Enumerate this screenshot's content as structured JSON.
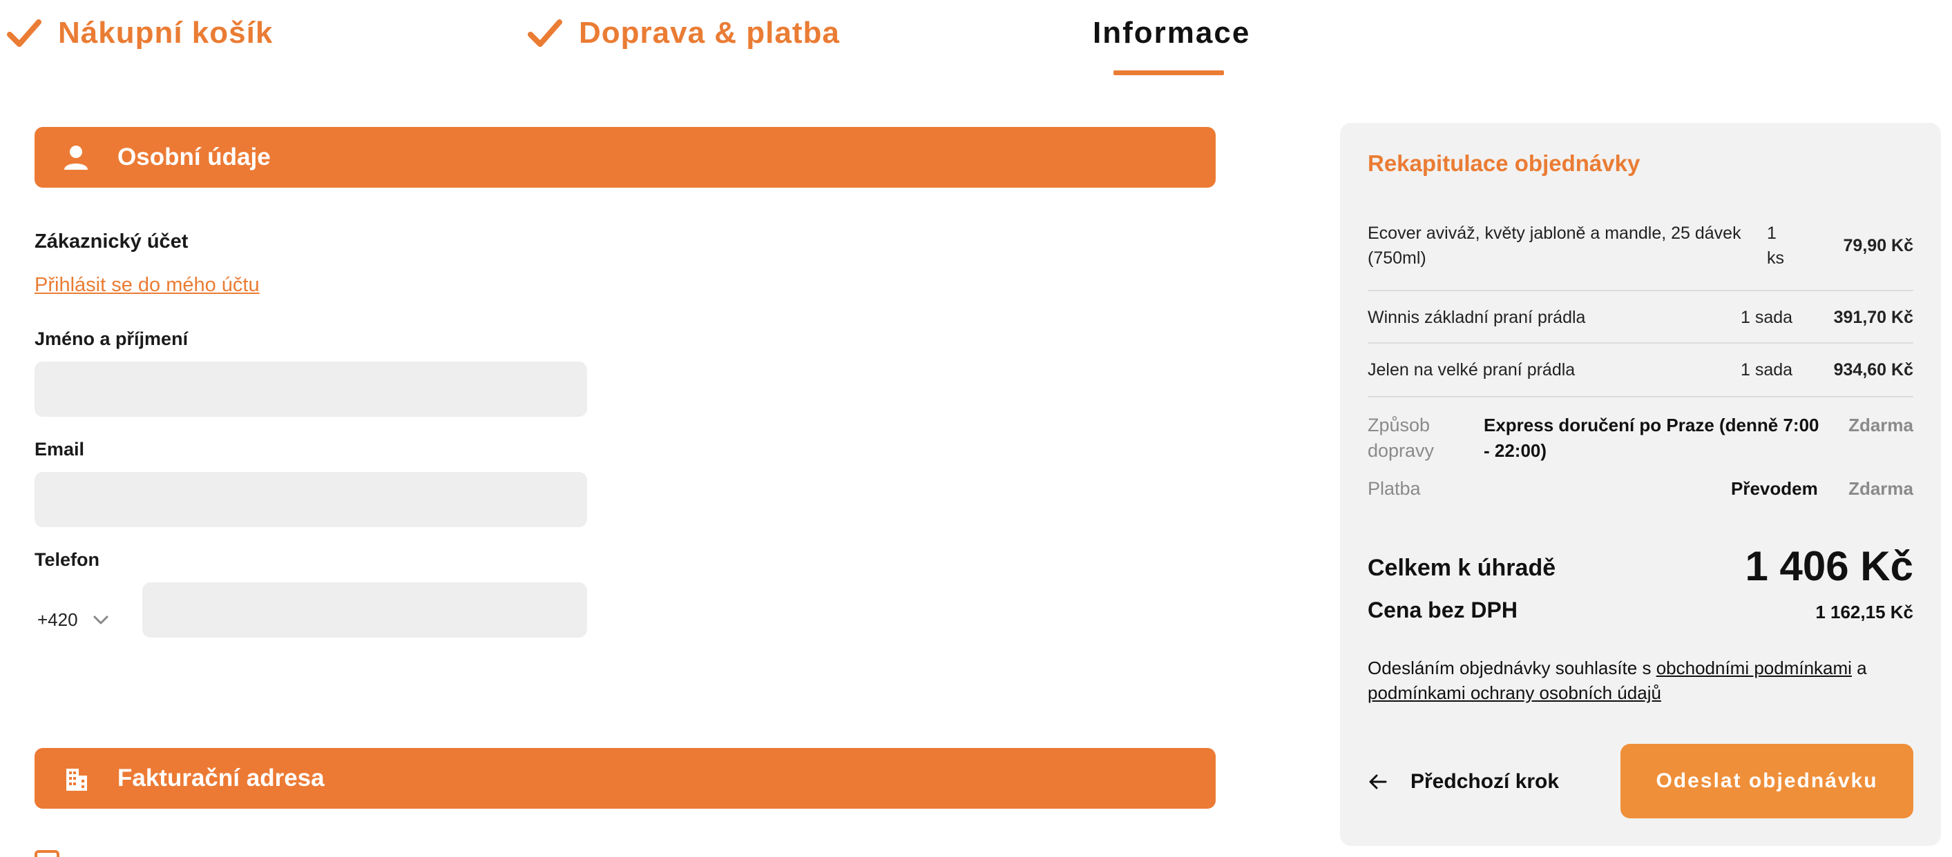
{
  "stepper": {
    "steps": [
      {
        "label": "Nákupní košík",
        "state": "done"
      },
      {
        "label": "Doprava & platba",
        "state": "done"
      },
      {
        "label": "Informace",
        "state": "current"
      }
    ]
  },
  "colors": {
    "accent": "#ea7c34",
    "button": "#ef8f3a",
    "panel_bg": "#f2f2f2",
    "input_bg": "#eeeeee"
  },
  "personal": {
    "section_title": "Osobní údaje",
    "section_icon": "person-icon",
    "account_label": "Zákaznický účet",
    "login_link": "Přihlásit se do mého účtu",
    "name_label": "Jméno a příjmení",
    "name_value": "",
    "email_label": "Email",
    "email_value": "",
    "phone_label": "Telefon",
    "phone_prefix": "+420",
    "phone_value": ""
  },
  "billing": {
    "section_title": "Fakturační adresa",
    "section_icon": "building-icon"
  },
  "summary": {
    "title": "Rekapitulace objednávky",
    "items": [
      {
        "name_line1": "Ecover aviváž, květy jabloně a mandle, 25 dávek",
        "name_line2": "(750ml)",
        "qty_line1": "1",
        "qty_line2": "ks",
        "price": "79,90 Kč"
      },
      {
        "name": "Winnis základní praní prádla",
        "qty": "1 sada",
        "price": "391,70 Kč"
      },
      {
        "name": "Jelen na velké praní prádla",
        "qty": "1 sada",
        "price": "934,60 Kč"
      }
    ],
    "shipping": {
      "label_line1": "Způsob",
      "label_line2": "dopravy",
      "value_line1": "Express doručení po Praze (denně 7:00",
      "value_line2": "- 22:00)",
      "price": "Zdarma"
    },
    "payment": {
      "label": "Platba",
      "value": "Převodem",
      "price": "Zdarma"
    },
    "total_label": "Celkem k úhradě",
    "total_value": "1 406 Kč",
    "net_label": "Cena bez DPH",
    "net_value": "1 162,15 Kč",
    "terms": {
      "prefix": "Odesláním objednávky souhlasíte s ",
      "link1": "obchodními podmínkami",
      "middle": " a",
      "link2": "podmínkami ochrany osobních údajů"
    },
    "back_label": "Předchozí krok",
    "submit_label": "Odeslat objednávku"
  }
}
